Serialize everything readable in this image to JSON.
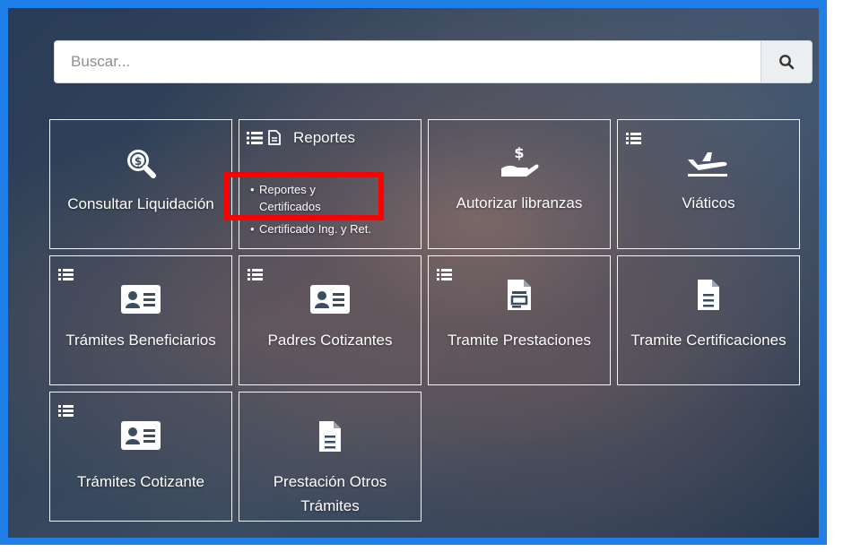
{
  "search": {
    "placeholder": "Buscar...",
    "icon": "search-icon"
  },
  "tiles": {
    "consultar": {
      "label": "Consultar Liquidación",
      "icon": "money-search-icon"
    },
    "reportes": {
      "title": "Reportes",
      "items": [
        "Reportes y Certificados",
        "Certificado Ing. y Ret."
      ]
    },
    "autorizar": {
      "label": "Autorizar libranzas",
      "icon": "hand-money-icon"
    },
    "viaticos": {
      "label": "Viáticos",
      "icon": "plane-icon"
    },
    "tramites_beneficiarios": {
      "label": "Trámites Beneficiarios",
      "icon": "id-card-icon"
    },
    "padres_cotizantes": {
      "label": "Padres Cotizantes",
      "icon": "id-card-icon"
    },
    "tramite_prestaciones": {
      "label": "Tramite Prestaciones",
      "icon": "document-icon"
    },
    "tramite_certificaciones": {
      "label": "Tramite Certificaciones",
      "icon": "file-icon"
    },
    "tramites_cotizante": {
      "label": "Trámites Cotizante",
      "icon": "id-card-icon"
    },
    "prestacion_otros": {
      "label": "Prestación Otros Trámites",
      "icon": "file-icon"
    }
  },
  "colors": {
    "frame": "#1f7fe6",
    "highlight": "#ff0000",
    "tile_border": "#ffffff"
  }
}
